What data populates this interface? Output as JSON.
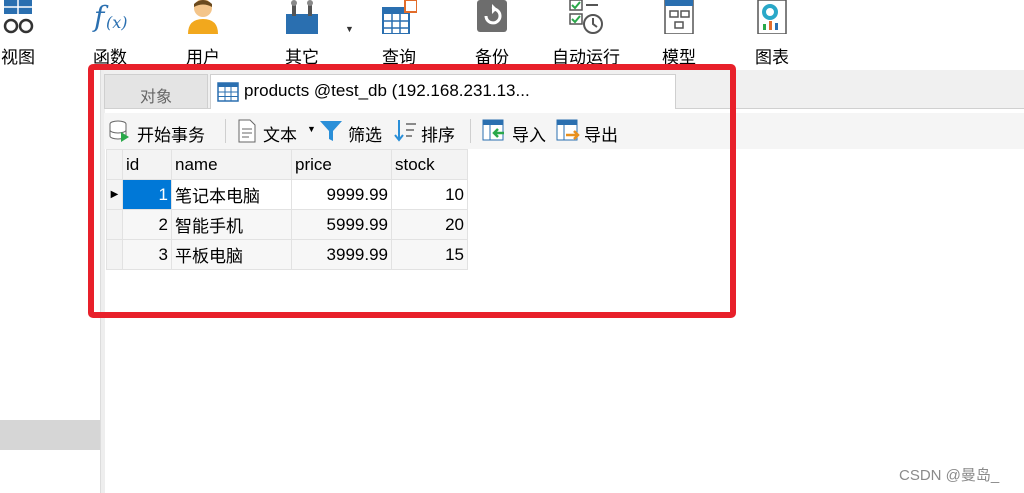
{
  "toolbar": {
    "items": [
      {
        "label": "视图",
        "icon": "view-icon"
      },
      {
        "label": "函数",
        "icon": "function-icon"
      },
      {
        "label": "用户",
        "icon": "user-icon"
      },
      {
        "label": "其它",
        "icon": "other-tools-icon"
      },
      {
        "label": "查询",
        "icon": "query-icon"
      },
      {
        "label": "备份",
        "icon": "backup-icon"
      },
      {
        "label": "自动运行",
        "icon": "automation-icon"
      },
      {
        "label": "模型",
        "icon": "model-icon"
      },
      {
        "label": "图表",
        "icon": "chart-icon"
      }
    ]
  },
  "tabs": {
    "objects": "对象",
    "table": "products @test_db (192.168.231.13..."
  },
  "datatools": {
    "begin_transaction": "开始事务",
    "text": "文本",
    "filter": "筛选",
    "sort": "排序",
    "import": "导入",
    "export": "导出"
  },
  "grid": {
    "columns": [
      "id",
      "name",
      "price",
      "stock"
    ],
    "rows": [
      {
        "id": "1",
        "name": "笔记本电脑",
        "price": "9999.99",
        "stock": "10"
      },
      {
        "id": "2",
        "name": "智能手机",
        "price": "5999.99",
        "stock": "20"
      },
      {
        "id": "3",
        "name": "平板电脑",
        "price": "3999.99",
        "stock": "15"
      }
    ]
  },
  "colors": {
    "highlight": "#e8202a",
    "selection": "#0078d7"
  },
  "watermark": "CSDN @曼岛_"
}
